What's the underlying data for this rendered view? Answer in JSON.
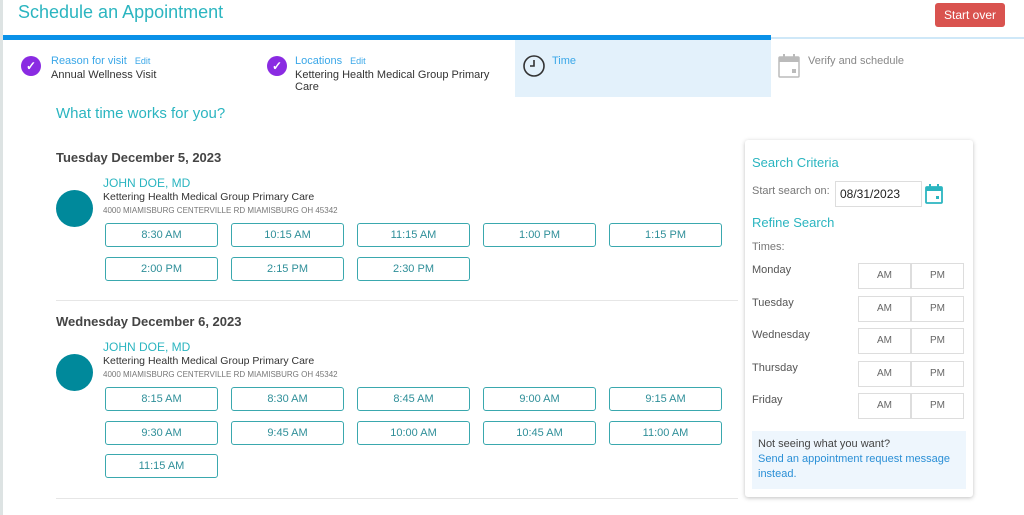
{
  "header": {
    "title": "Schedule an Appointment",
    "start_over": "Start over"
  },
  "steps": [
    {
      "label": "Reason for visit",
      "edit": "Edit",
      "value": "Annual Wellness Visit",
      "state": "complete"
    },
    {
      "label": "Locations",
      "edit": "Edit",
      "value": "Kettering Health Medical Group Primary Care",
      "state": "complete"
    },
    {
      "label": "Time",
      "state": "active"
    },
    {
      "label": "Verify and schedule",
      "state": "upcoming"
    }
  ],
  "main": {
    "heading": "What time works for you?",
    "days": [
      {
        "date": "Tuesday December 5, 2023",
        "doctor": "JOHN DOE, MD",
        "location": "Kettering Health Medical Group Primary Care",
        "address": "4000 MIAMISBURG CENTERVILLE RD MIAMISBURG OH 45342",
        "slots": [
          "8:30 AM",
          "10:15 AM",
          "11:15 AM",
          "1:00 PM",
          "1:15 PM",
          "2:00 PM",
          "2:15 PM",
          "2:30 PM"
        ]
      },
      {
        "date": "Wednesday December 6, 2023",
        "doctor": "JOHN DOE, MD",
        "location": "Kettering Health Medical Group Primary Care",
        "address": "4000 MIAMISBURG CENTERVILLE RD MIAMISBURG OH 45342",
        "slots": [
          "8:15 AM",
          "8:30 AM",
          "8:45 AM",
          "9:00 AM",
          "9:15 AM",
          "9:30 AM",
          "9:45 AM",
          "10:00 AM",
          "10:45 AM",
          "11:00 AM",
          "11:15 AM"
        ]
      }
    ]
  },
  "panel": {
    "search_criteria": "Search Criteria",
    "start_label": "Start search on:",
    "start_value": "08/31/2023",
    "refine": "Refine Search",
    "times": "Times:",
    "days": [
      "Monday",
      "Tuesday",
      "Wednesday",
      "Thursday",
      "Friday"
    ],
    "am": "AM",
    "pm": "PM",
    "not_seeing": "Not seeing what you want?",
    "link": "Send an appointment request message instead."
  },
  "colors": {
    "accent": "#2bb5c0",
    "progress": "#0a91e8",
    "start_over": "#d9534f",
    "check": "#8a2be2",
    "avatar": "#00899b"
  }
}
